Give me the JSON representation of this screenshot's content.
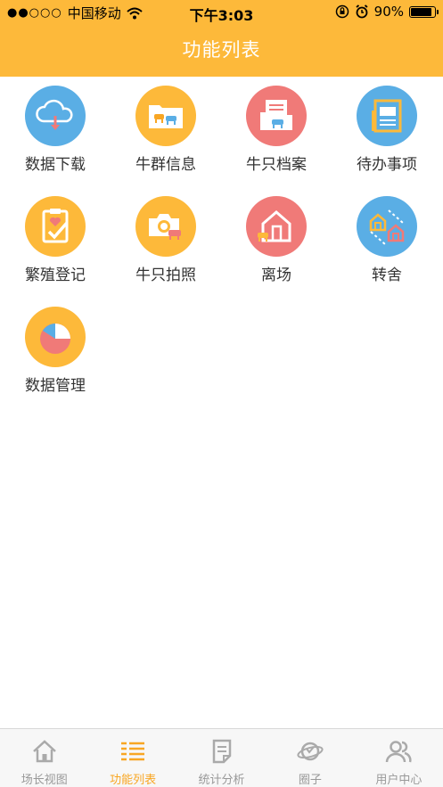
{
  "status_bar": {
    "carrier": "中国移动",
    "time": "下午3:03",
    "battery_percent": "90%",
    "battery_level": 0.9
  },
  "header": {
    "title": "功能列表"
  },
  "colors": {
    "accent": "#FDB93A",
    "blue": "#5AAEE5",
    "yellow": "#FDB93A",
    "red": "#F07A78"
  },
  "functions": [
    {
      "label": "数据下载",
      "icon": "cloud-download-icon"
    },
    {
      "label": "牛群信息",
      "icon": "cattle-folder-icon"
    },
    {
      "label": "牛只档案",
      "icon": "cattle-file-icon"
    },
    {
      "label": "待办事项",
      "icon": "todo-document-icon"
    },
    {
      "label": "繁殖登记",
      "icon": "breeding-clipboard-icon"
    },
    {
      "label": "牛只拍照",
      "icon": "camera-icon"
    },
    {
      "label": "离场",
      "icon": "barn-exit-icon"
    },
    {
      "label": "转舍",
      "icon": "barn-transfer-icon"
    },
    {
      "label": "数据管理",
      "icon": "pie-chart-icon"
    }
  ],
  "tabbar": {
    "active": "功能列表",
    "tabs": [
      {
        "label": "场长视图",
        "icon": "home-icon"
      },
      {
        "label": "功能列表",
        "icon": "list-icon"
      },
      {
        "label": "统计分析",
        "icon": "report-icon"
      },
      {
        "label": "圈子",
        "icon": "planet-icon"
      },
      {
        "label": "用户中心",
        "icon": "user-icon"
      }
    ]
  }
}
